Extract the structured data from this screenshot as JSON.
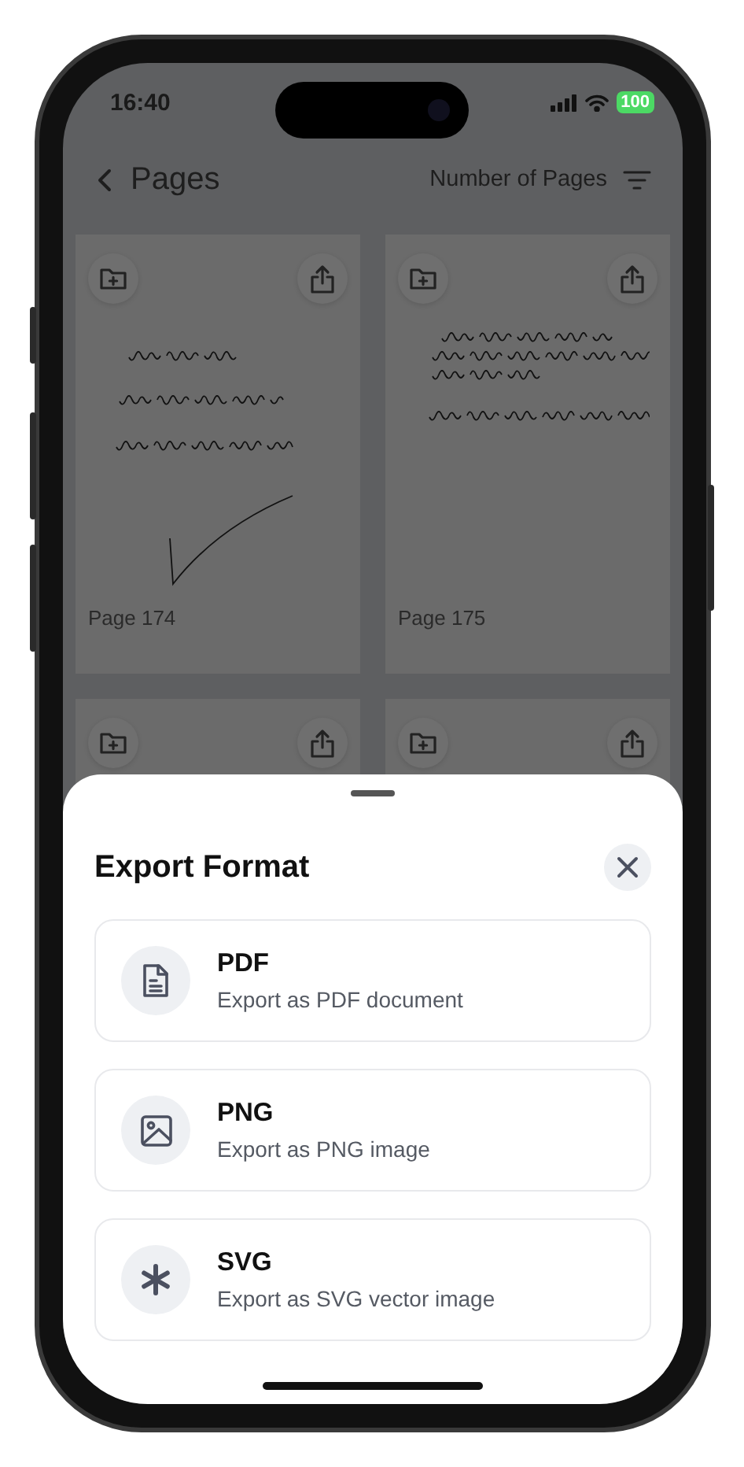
{
  "status_bar": {
    "time": "16:40",
    "battery": "100"
  },
  "header": {
    "title": "Pages",
    "sort_label": "Number of Pages"
  },
  "pages": [
    {
      "kind": "note",
      "label": "Page 174"
    },
    {
      "kind": "note",
      "label": "Page 175"
    },
    {
      "kind": "blank"
    },
    {
      "kind": "blank"
    }
  ],
  "sheet": {
    "title": "Export Format",
    "options": [
      {
        "kind": "pdf",
        "title": "PDF",
        "subtitle": "Export as PDF document"
      },
      {
        "kind": "png",
        "title": "PNG",
        "subtitle": "Export as PNG image"
      },
      {
        "kind": "svg",
        "title": "SVG",
        "subtitle": "Export as SVG vector image"
      }
    ]
  }
}
